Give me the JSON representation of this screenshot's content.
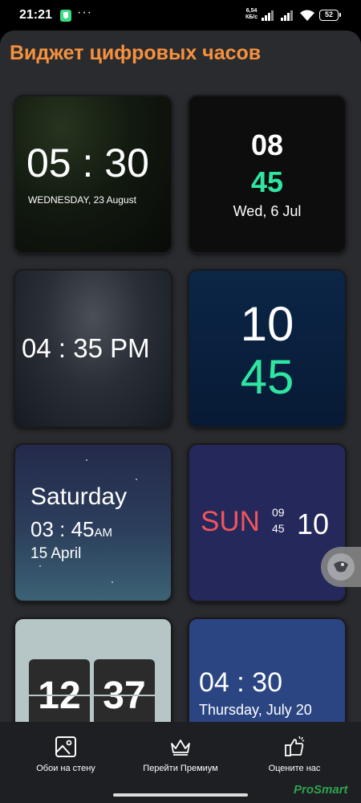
{
  "status_bar": {
    "time": "21:21",
    "dots": "···",
    "speed_value": "6,54",
    "speed_unit": "КБ/с",
    "battery": "52"
  },
  "app": {
    "title": "Виджет цифровых часов"
  },
  "widgets": {
    "w1": {
      "time": "05 : 30",
      "date": "WEDNESDAY,  23 August"
    },
    "w2": {
      "hour": "08",
      "minute": "45",
      "date": "Wed, 6 Jul"
    },
    "w3": {
      "time": "04 : 35 PM"
    },
    "w4": {
      "hour": "10",
      "minute": "45"
    },
    "w5": {
      "day": "Saturday",
      "time": "03 : 45",
      "ampm": "AM",
      "date": "15 April"
    },
    "w6": {
      "day": "SUN",
      "hour": "09",
      "minute": "45",
      "seconds": "10"
    },
    "w7": {
      "hour": "12",
      "minute": "37"
    },
    "w8": {
      "time": "04 : 30",
      "date": "Thursday, July 20"
    }
  },
  "bottom_nav": {
    "items": [
      {
        "label": "Обои на стену",
        "icon": "image-icon"
      },
      {
        "label": "Перейти Премиум",
        "icon": "crown-icon"
      },
      {
        "label": "Оцените нас",
        "icon": "thumbs-up-icon"
      }
    ]
  },
  "watermark": "ProSmart",
  "colors": {
    "title_orange": "#f6913e",
    "accent_green": "#2fe6a0",
    "accent_red": "#f0555e"
  }
}
